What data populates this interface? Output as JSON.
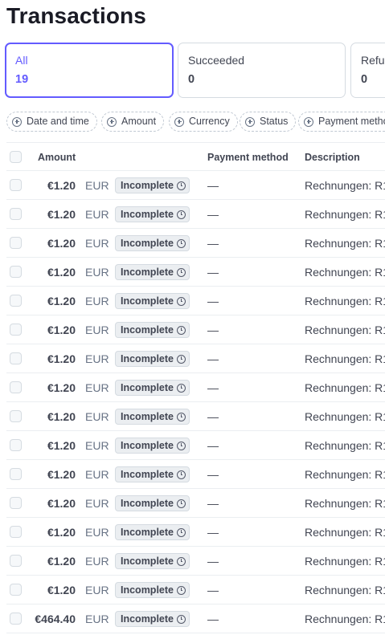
{
  "page": {
    "title": "Transactions"
  },
  "cards": [
    {
      "label": "All",
      "count": "19",
      "selected": true
    },
    {
      "label": "Succeeded",
      "count": "0",
      "selected": false
    },
    {
      "label": "Refun",
      "count": "0",
      "selected": false
    }
  ],
  "filters": [
    "Date and time",
    "Amount",
    "Currency",
    "Status",
    "Payment metho"
  ],
  "table": {
    "headers": {
      "amount": "Amount",
      "payment_method": "Payment method",
      "description": "Description"
    },
    "rows": [
      {
        "amount": "€1.20",
        "currency": "EUR",
        "status": "Incomplete",
        "payment_method": "—",
        "description": "Rechnungen: R1"
      },
      {
        "amount": "€1.20",
        "currency": "EUR",
        "status": "Incomplete",
        "payment_method": "—",
        "description": "Rechnungen: R1"
      },
      {
        "amount": "€1.20",
        "currency": "EUR",
        "status": "Incomplete",
        "payment_method": "—",
        "description": "Rechnungen: R1"
      },
      {
        "amount": "€1.20",
        "currency": "EUR",
        "status": "Incomplete",
        "payment_method": "—",
        "description": "Rechnungen: R1"
      },
      {
        "amount": "€1.20",
        "currency": "EUR",
        "status": "Incomplete",
        "payment_method": "—",
        "description": "Rechnungen: R1"
      },
      {
        "amount": "€1.20",
        "currency": "EUR",
        "status": "Incomplete",
        "payment_method": "—",
        "description": "Rechnungen: R1"
      },
      {
        "amount": "€1.20",
        "currency": "EUR",
        "status": "Incomplete",
        "payment_method": "—",
        "description": "Rechnungen: R1"
      },
      {
        "amount": "€1.20",
        "currency": "EUR",
        "status": "Incomplete",
        "payment_method": "—",
        "description": "Rechnungen: R1"
      },
      {
        "amount": "€1.20",
        "currency": "EUR",
        "status": "Incomplete",
        "payment_method": "—",
        "description": "Rechnungen: R1"
      },
      {
        "amount": "€1.20",
        "currency": "EUR",
        "status": "Incomplete",
        "payment_method": "—",
        "description": "Rechnungen: R1"
      },
      {
        "amount": "€1.20",
        "currency": "EUR",
        "status": "Incomplete",
        "payment_method": "—",
        "description": "Rechnungen: R1"
      },
      {
        "amount": "€1.20",
        "currency": "EUR",
        "status": "Incomplete",
        "payment_method": "—",
        "description": "Rechnungen: R1"
      },
      {
        "amount": "€1.20",
        "currency": "EUR",
        "status": "Incomplete",
        "payment_method": "—",
        "description": "Rechnungen: R1"
      },
      {
        "amount": "€1.20",
        "currency": "EUR",
        "status": "Incomplete",
        "payment_method": "—",
        "description": "Rechnungen: R1"
      },
      {
        "amount": "€1.20",
        "currency": "EUR",
        "status": "Incomplete",
        "payment_method": "—",
        "description": "Rechnungen: R1"
      },
      {
        "amount": "€464.40",
        "currency": "EUR",
        "status": "Incomplete",
        "payment_method": "—",
        "description": "Rechnungen: R1"
      }
    ]
  },
  "colors": {
    "accent": "#635bff",
    "text": "#414552",
    "border": "#d5dbe1",
    "badge_bg": "#ebeef1"
  },
  "icons": {
    "filter_chip": "plus-circle-icon",
    "status": "clock-icon"
  }
}
